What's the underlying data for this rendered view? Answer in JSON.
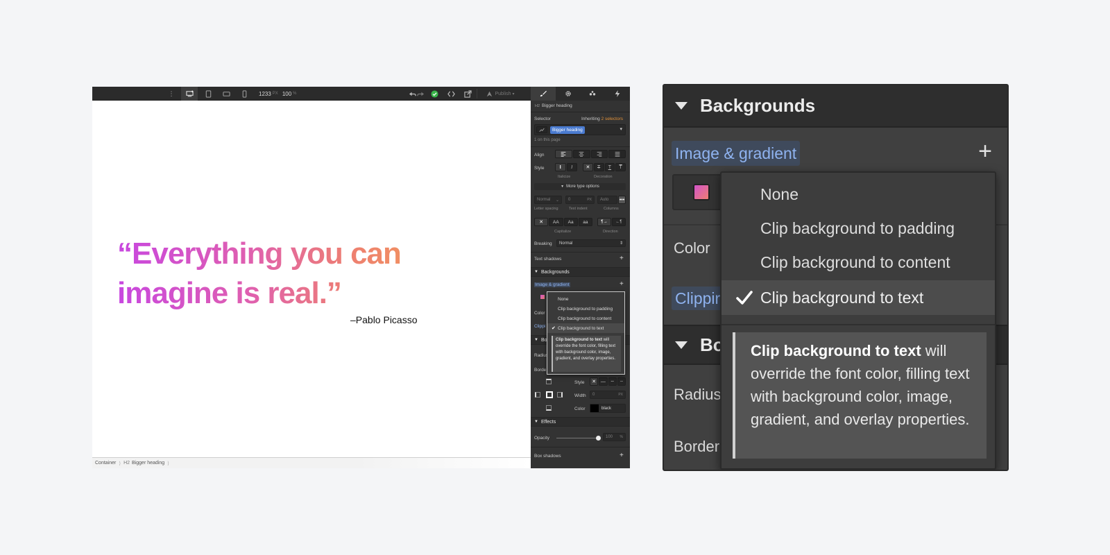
{
  "designer": {
    "toolbar": {
      "viewport_width": "1233",
      "viewport_unit": "PX",
      "zoom": "100",
      "zoom_unit": "%",
      "publish_label": "Publish"
    },
    "canvas": {
      "quote_line1": "“Everything you can",
      "quote_line2": "imagine is real.”",
      "author": "–Pablo Picasso"
    },
    "breadcrumb": [
      "Container",
      "Bigger heading"
    ],
    "panel": {
      "element_tag": "H2",
      "element_name": "Bigger heading",
      "selector_label": "Selector",
      "inheriting_label": "Inheriting",
      "inheriting_count": "2 selectors",
      "selector_value": "Bigger heading",
      "on_page": "1 on this page",
      "align_label": "Align",
      "style_label": "Style",
      "italicize_label": "Italicize",
      "decoration_label": "Decoration",
      "more_type_options": "More type options",
      "letter_spacing_value": "Normal",
      "text_indent_value": "0",
      "text_indent_unit": "PX",
      "columns_value": "Auto",
      "letter_spacing_label": "Letter spacing",
      "text_indent_label": "Text indent",
      "columns_label": "Columns",
      "capitalize_label": "Capitalize",
      "direction_label": "Direction",
      "cap_options": [
        "AA",
        "Aa",
        "aa"
      ],
      "breaking_label": "Breaking",
      "breaking_value": "Normal",
      "text_shadows_label": "Text shadows",
      "backgrounds_label": "Backgrounds",
      "image_gradient_label": "Image & gradient",
      "color_label": "Color",
      "clipping_label": "Clippi",
      "borders_label": "Bo",
      "radius_label": "Radius",
      "borders_row_label": "Borde",
      "border_style_label": "Style",
      "border_width_label": "Width",
      "border_width_value": "0",
      "border_width_unit": "PX",
      "border_color_label": "Color",
      "border_color_value": "black",
      "effects_label": "Effects",
      "opacity_label": "Opacity",
      "opacity_value": "100",
      "opacity_unit": "%",
      "box_shadows_label": "Box shadows"
    },
    "mini_dropdown": {
      "options": [
        "None",
        "Clip background to padding",
        "Clip background to content",
        "Clip background to text"
      ],
      "tip_bold": "Clip background to text",
      "tip_rest": " will override the font color, filling text with background color, image, gradient, and overlay properties."
    }
  },
  "zoom_panel": {
    "section_title": "Backgrounds",
    "image_gradient_label": "Image & gradient",
    "color_label": "Color",
    "clipping_label": "Clippir",
    "borders_title": "Bo",
    "radius_label": "Radius",
    "border_label": "Border",
    "dropdown": {
      "options": [
        "None",
        "Clip background to padding",
        "Clip background to content",
        "Clip background to text"
      ],
      "selected": "Clip background to text",
      "tip_bold": "Clip background to text",
      "tip_rest": " will override the font color, filling text with background color, image, gradient, and overlay properties."
    }
  },
  "colors": {
    "gradient_start": "#c847e0",
    "gradient_end": "#f29a58",
    "accent_blue": "#8fb3f0",
    "selector_blue": "#4a7bd0",
    "inherit_orange": "#e0913a"
  }
}
